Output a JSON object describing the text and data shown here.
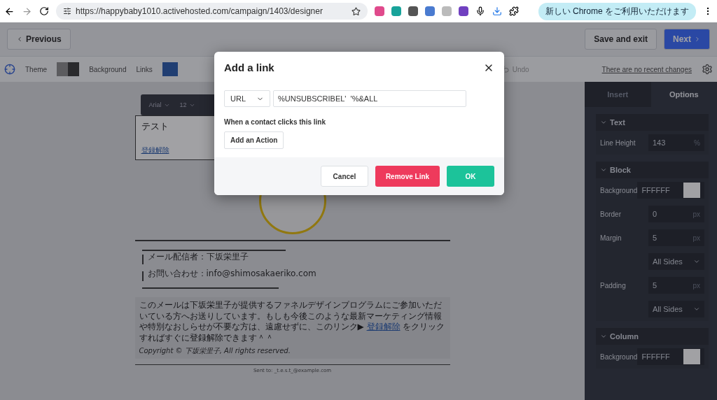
{
  "browser": {
    "url": "https://happybaby1010.activehosted.com/campaign/1403/designer",
    "update_badge": "新しい Chrome をご利用いただけます"
  },
  "header": {
    "previous": "Previous",
    "save_exit": "Save and exit",
    "next": "Next"
  },
  "toolbar": {
    "theme": "Theme",
    "background": "Background",
    "links": "Links",
    "undo": "Undo",
    "status": "There are no recent changes"
  },
  "email": {
    "font": "Arial",
    "size": "12",
    "heading": "テスト",
    "unsubscribe": "登録解除",
    "sender": "メール配信者：下坂栄里子",
    "contact": "お問い合わせ：info@shimosakaeriko.com",
    "footer_before": "このメールは下坂栄里子が提供するファネルデザインプログラムにご参加いただいている方へお送りしています。もしも今後このような最新マーケティング情報や特別なおしらせが不要な方は、遠慮せずに、このリンク▶ ",
    "footer_link": "登録解除",
    "footer_after": " をクリックすればすぐに登録解除できます＾＾",
    "copyright": "Copyright ©  下坂栄里子, All rights reserved.",
    "sent_to": "Sent to: _t.e.s.t_@example.com"
  },
  "panel": {
    "tabs": [
      {
        "label": "Insert",
        "selected": false
      },
      {
        "label": "Options",
        "selected": true
      }
    ],
    "sections": [
      {
        "title": "Text",
        "expanded": true,
        "rows": [
          {
            "kind": "number",
            "label": "Line Height",
            "value": "143",
            "unit": "%"
          }
        ]
      },
      {
        "title": "Block",
        "expanded": true,
        "rows": [
          {
            "kind": "color",
            "label": "Background",
            "value": "FFFFFF"
          },
          {
            "kind": "number",
            "label": "Border",
            "value": "0",
            "unit": "px"
          },
          {
            "kind": "number",
            "label": "Margin",
            "value": "5",
            "unit": "px"
          },
          {
            "kind": "select",
            "value": "All Sides"
          },
          {
            "kind": "number",
            "label": "Padding",
            "value": "5",
            "unit": "px"
          },
          {
            "kind": "select",
            "value": "All Sides"
          }
        ]
      },
      {
        "title": "Column",
        "expanded": true,
        "rows": [
          {
            "kind": "color",
            "label": "Background",
            "value": "FFFFFF"
          }
        ]
      }
    ]
  },
  "dialog": {
    "title": "Add a link",
    "type": "URL",
    "url": "%UNSUBSCRIBEL'  '%&ALL",
    "hint": "When a contact clicks this link",
    "add_action": "Add an Action",
    "cancel": "Cancel",
    "remove": "Remove Link",
    "ok": "OK"
  }
}
